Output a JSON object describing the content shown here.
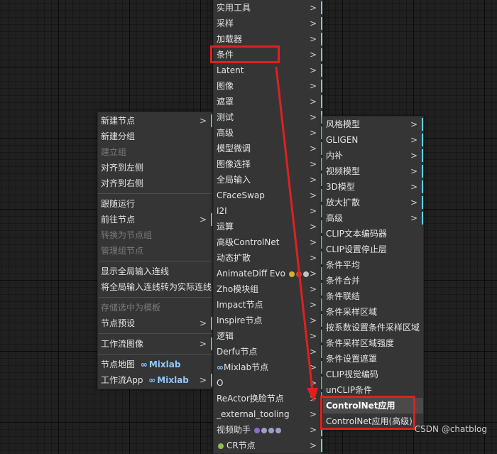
{
  "left_menu": {
    "items": [
      "新建节点",
      "新建分组",
      "建立组",
      "对齐到左侧",
      "对齐到右侧",
      "跟随运行",
      "前往节点",
      "转换为节点组",
      "管理组节点",
      "显示全局输入连线",
      "将全局输入连线转为实际连线",
      "存储选中为模板",
      "节点预设",
      "工作流图像",
      "节点地图",
      "工作流App"
    ],
    "mixlab": "Mixlab"
  },
  "mid_menu": {
    "items": [
      "实用工具",
      "采样",
      "加载器",
      "条件",
      "Latent",
      "图像",
      "遮罩",
      "测试",
      "高级",
      "模型微调",
      "图像选择",
      "全局输入",
      "CFaceSwap",
      "I2I",
      "运算",
      "高级ControlNet",
      "动态扩散",
      "AnimateDiff Evo",
      "Zho模块组",
      "Impact节点",
      "Inspire节点",
      "逻辑",
      "Derfu节点",
      "Mixlab节点",
      "O",
      "ReActor换脸节点",
      "_external_tooling",
      "视频助手",
      "CR节点"
    ]
  },
  "right_menu": {
    "items": [
      "风格模型",
      "GLIGEN",
      "内补",
      "视频模型",
      "3D模型",
      "放大扩散",
      "高级",
      "CLIP文本编码器",
      "CLIP设置停止层",
      "条件平均",
      "条件合并",
      "条件联结",
      "条件采样区域",
      "按系数设置条件采样区域",
      "条件采样区域强度",
      "条件设置遮罩",
      "CLIP视觉编码",
      "unCLIP条件",
      "ControlNet应用",
      "ControlNet应用(高级)"
    ]
  },
  "arrow_glyph": ">",
  "watermark": "CSDN @chatblog",
  "colors": {
    "highlight_box": "#e02020",
    "accent": "#5fd2e0",
    "menu_bg": "#353535"
  }
}
